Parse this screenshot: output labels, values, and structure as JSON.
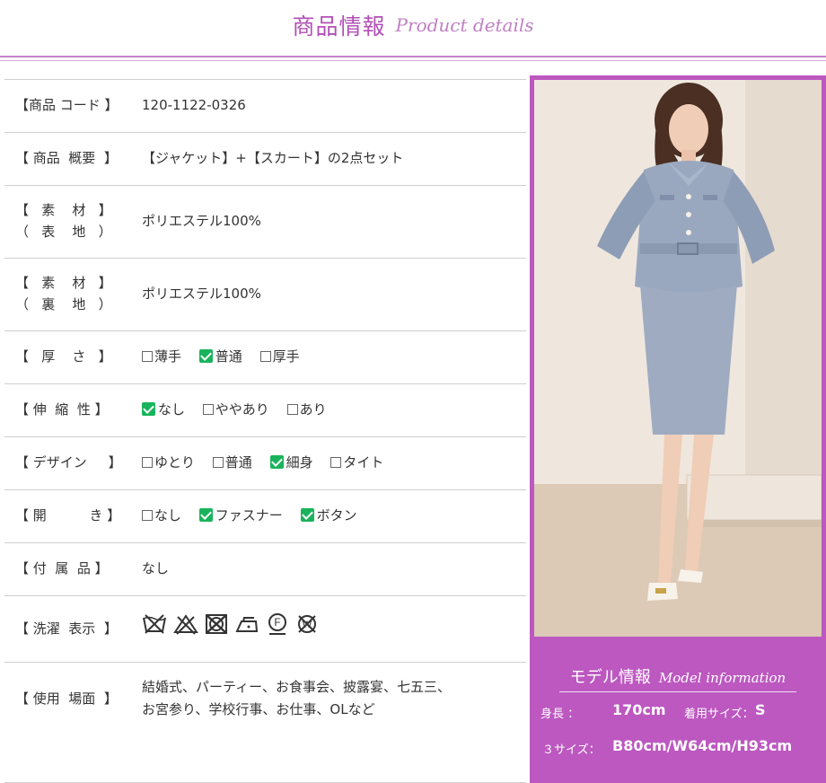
{
  "header": {
    "title_jp": "商品情報",
    "title_en": "Product details"
  },
  "rows": {
    "code": {
      "label": "【商品 コード 】",
      "value": "120-1122-0326"
    },
    "summary": {
      "label": "【 商品  概要  】",
      "value": "【ジャケット】+【スカート】の2点セット"
    },
    "material_outer": {
      "label1": "【   素    材   】",
      "label2": "（   表    地   ）",
      "value": "ポリエステル100%"
    },
    "material_lining": {
      "label1": "【   素    材   】",
      "label2": "（   裏    地   ）",
      "value": "ポリエステル100%"
    },
    "thickness": {
      "label": "【   厚    さ   】",
      "options": [
        {
          "text": "薄手",
          "checked": false
        },
        {
          "text": "普通",
          "checked": true
        },
        {
          "text": "厚手",
          "checked": false
        }
      ]
    },
    "stretch": {
      "label": "【 伸  縮  性 】",
      "options": [
        {
          "text": "なし",
          "checked": true
        },
        {
          "text": "ややあり",
          "checked": false
        },
        {
          "text": "あり",
          "checked": false
        }
      ]
    },
    "design": {
      "label": "【 デザイン     】",
      "options": [
        {
          "text": "ゆとり",
          "checked": false
        },
        {
          "text": "普通",
          "checked": false
        },
        {
          "text": "細身",
          "checked": true
        },
        {
          "text": "タイト",
          "checked": false
        }
      ]
    },
    "opening": {
      "label": "【 開          き 】",
      "options": [
        {
          "text": "なし",
          "checked": false
        },
        {
          "text": "ファスナー",
          "checked": true
        },
        {
          "text": "ボタン",
          "checked": true
        }
      ]
    },
    "accessories": {
      "label": "【 付  属  品 】",
      "value": "なし"
    },
    "washing": {
      "label": "【 洗濯  表示  】",
      "icons": [
        "no-wash-icon",
        "no-bleach-icon",
        "no-tumble-dry-icon",
        "iron-low-icon",
        "dry-clean-f-icon",
        "no-wet-clean-icon"
      ]
    },
    "scene": {
      "label": "【 使用  場面  】",
      "line1": "結婚式、パーティー、お食事会、披露宴、七五三、",
      "line2": "お宮参り、学校行事、お仕事、OLなど"
    }
  },
  "model": {
    "title_jp": "モデル情報",
    "title_en": "Model information",
    "height_label": "身長        ：",
    "height_value": "170cm",
    "size_label": "着用サイズ：",
    "size_value": "S",
    "three_size_label": "３サイズ：",
    "three_size_value": "B80cm/W64cm/H93cm"
  },
  "colors": {
    "accent": "#bc58c0",
    "check": "#19b35c"
  }
}
